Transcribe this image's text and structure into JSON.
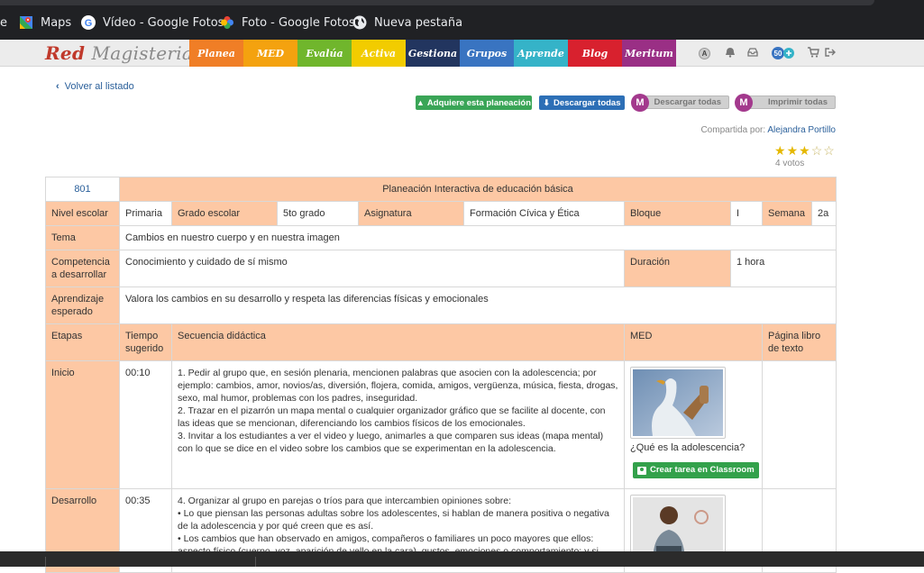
{
  "bookmarks": [
    {
      "label": "e",
      "icon": "partial-icon"
    },
    {
      "label": "Maps",
      "icon": "maps-icon"
    },
    {
      "label": "Vídeo - Google Fotos",
      "icon": "google-icon"
    },
    {
      "label": "Foto - Google Fotos",
      "icon": "google-photos-icon"
    },
    {
      "label": "Nueva pestaña",
      "icon": "globe-icon"
    }
  ],
  "site": {
    "logo_red": "Red",
    "logo_mag": "Magisterial",
    "logo_reg": "®",
    "tabs": [
      {
        "label": "Planea",
        "color": "#f07e26"
      },
      {
        "label": "MED",
        "color": "#f4a20f"
      },
      {
        "label": "Evalúa",
        "color": "#70b62c"
      },
      {
        "label": "Activa",
        "color": "#f2cc00"
      },
      {
        "label": "Gestiona",
        "color": "#22355f"
      },
      {
        "label": "Grupos",
        "color": "#3974c1"
      },
      {
        "label": "Aprende",
        "color": "#35b3c8"
      },
      {
        "label": "Blog",
        "color": "#d8212e"
      },
      {
        "label": "Meritum",
        "color": "#9a2f85"
      }
    ],
    "icons": {
      "a_badge": "A",
      "count_badge": "50"
    }
  },
  "actions": {
    "back": "Volver al listado",
    "buy": "Adquiere esta planeación",
    "download_all": "Descargar todas",
    "m_download": "Descargar todas",
    "m_print": "Imprimir todas",
    "m_badge": "M"
  },
  "shared": {
    "prefix": "Compartida por:",
    "author": "Alejandra Portillo"
  },
  "rating": {
    "stars": 3,
    "max": 5,
    "votes": "4 votos"
  },
  "plan": {
    "id": "801",
    "title": "Planeación Interactiva de educación básica",
    "nivel_label": "Nivel escolar",
    "nivel": "Primaria",
    "grado_label": "Grado escolar",
    "grado": "5to grado",
    "asignatura_label": "Asignatura",
    "asignatura": "Formación Cívica y Ética",
    "bloque_label": "Bloque",
    "bloque": "I",
    "semana_label": "Semana",
    "semana": "2a",
    "tema_label": "Tema",
    "tema": "Cambios en nuestro cuerpo y en nuestra imagen",
    "competencia_label": "Competencia a desarrollar",
    "competencia": "Conocimiento y cuidado de sí mismo",
    "duracion_label": "Duración",
    "duracion": "1 hora",
    "aprendizaje_label": "Aprendizaje esperado",
    "aprendizaje": "Valora los cambios en su desarrollo y respeta las diferencias físicas y emocionales",
    "headers": {
      "etapas": "Etapas",
      "tiempo": "Tiempo sugerido",
      "secuencia": "Secuencia didáctica",
      "med": "MED",
      "pagina": "Página libro de texto"
    },
    "rows": [
      {
        "etapa": "Inicio",
        "tiempo": "00:10",
        "secuencia": [
          "1. Pedir al grupo que, en sesión plenaria, mencionen palabras que asocien con la adolescencia; por ejemplo: cambios, amor, novios/as, diversión, flojera, comida, amigos, vergüenza, música, fiesta, drogas, sexo, mal humor, problemas con los padres, inseguridad.",
          "2. Trazar en el pizarrón un mapa mental o cualquier organizador gráfico que se facilite al docente, con las ideas que se mencionan, diferenciando los cambios físicos de los emocionales.",
          "3. Invitar a los estudiantes a ver el video y luego, animarles a que comparen sus ideas (mapa mental) con lo que se dice en el video sobre los cambios que se experimentan en la adolescencia."
        ],
        "med_caption": "¿Qué es la adolescencia?",
        "classroom": "Crear tarea en Classroom"
      },
      {
        "etapa": "Desarrollo",
        "tiempo": "00:35",
        "secuencia": [
          "4. Organizar al grupo en parejas o tríos para que intercambien opiniones sobre:",
          "• Lo que piensan las personas adultas sobre los adolescentes, si hablan de manera positiva o negativa de la adolescencia y por qué creen que es así.",
          "• Los cambios que han observado en amigos, compañeros o familiares un poco mayores que ellos: aspecto físico (cuerpo, voz, aparición de vello en la cara), gustos, emociones o comportamiento; y si"
        ]
      }
    ]
  }
}
